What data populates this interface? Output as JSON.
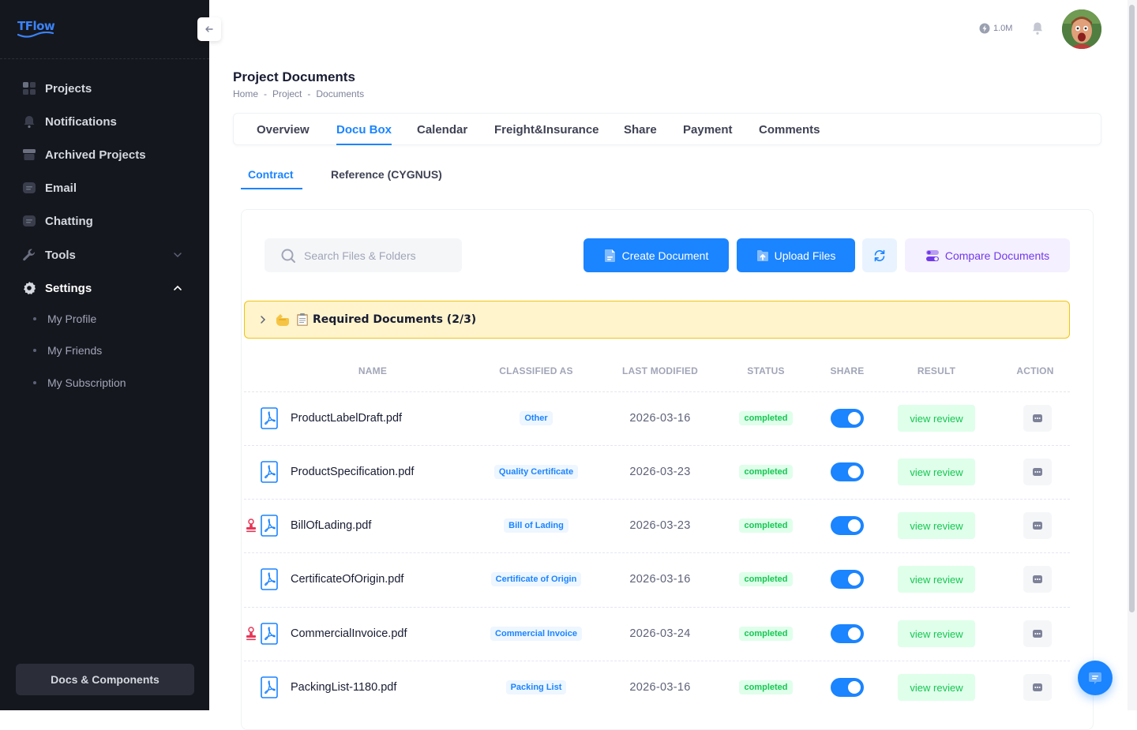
{
  "brand": {
    "name": "TFlow"
  },
  "sidebar": {
    "items": [
      {
        "label": "Projects",
        "icon": "grid-icon"
      },
      {
        "label": "Notifications",
        "icon": "bell-icon"
      },
      {
        "label": "Archived Projects",
        "icon": "archive-icon"
      },
      {
        "label": "Email",
        "icon": "message-icon"
      },
      {
        "label": "Chatting",
        "icon": "message-icon"
      },
      {
        "label": "Tools",
        "icon": "wrench-icon"
      },
      {
        "label": "Settings",
        "icon": "gear-icon"
      }
    ],
    "settings_sub": [
      {
        "label": "My Profile"
      },
      {
        "label": "My Friends"
      },
      {
        "label": "My Subscription"
      }
    ],
    "docs_button": "Docs & Components"
  },
  "topbar": {
    "credits": "1.0M"
  },
  "page": {
    "title": "Project Documents",
    "breadcrumb": [
      "Home",
      "Project",
      "Documents"
    ]
  },
  "tabs": [
    "Overview",
    "Docu Box",
    "Calendar",
    "Freight&Insurance",
    "Share",
    "Payment",
    "Comments"
  ],
  "active_tab": "Docu Box",
  "subtabs": [
    "Contract",
    "Reference (CYGNUS)"
  ],
  "active_subtab": "Contract",
  "toolbar": {
    "search_placeholder": "Search Files & Folders",
    "create_label": "Create Document",
    "upload_label": "Upload Files",
    "compare_label": "Compare Documents"
  },
  "required_docs": {
    "label": "Required Documents (2/3)"
  },
  "table": {
    "headers": [
      "NAME",
      "CLASSIFIED AS",
      "LAST MODIFIED",
      "STATUS",
      "SHARE",
      "RESULT",
      "ACTION"
    ],
    "rows": [
      {
        "name": "ProductLabelDraft.pdf",
        "classified": "Other",
        "modified": "2026-03-16",
        "status": "completed",
        "share": true,
        "result": "view review",
        "stamp": false
      },
      {
        "name": "ProductSpecification.pdf",
        "classified": "Quality Certificate",
        "modified": "2026-03-23",
        "status": "completed",
        "share": true,
        "result": "view review",
        "stamp": false
      },
      {
        "name": "BillOfLading.pdf",
        "classified": "Bill of Lading",
        "modified": "2026-03-23",
        "status": "completed",
        "share": true,
        "result": "view review",
        "stamp": true
      },
      {
        "name": "CertificateOfOrigin.pdf",
        "classified": "Certificate of Origin",
        "modified": "2026-03-16",
        "status": "completed",
        "share": true,
        "result": "view review",
        "stamp": false
      },
      {
        "name": "CommercialInvoice.pdf",
        "classified": "Commercial Invoice",
        "modified": "2026-03-24",
        "status": "completed",
        "share": true,
        "result": "view review",
        "stamp": true
      },
      {
        "name": "PackingList-1180.pdf",
        "classified": "Packing List",
        "modified": "2026-03-16",
        "status": "completed",
        "share": true,
        "result": "view review",
        "stamp": false
      }
    ]
  },
  "colors": {
    "primary": "#1b84ff",
    "success": "#17c653",
    "sidebar": "#15171e",
    "warning_bg": "#fff4cc"
  }
}
